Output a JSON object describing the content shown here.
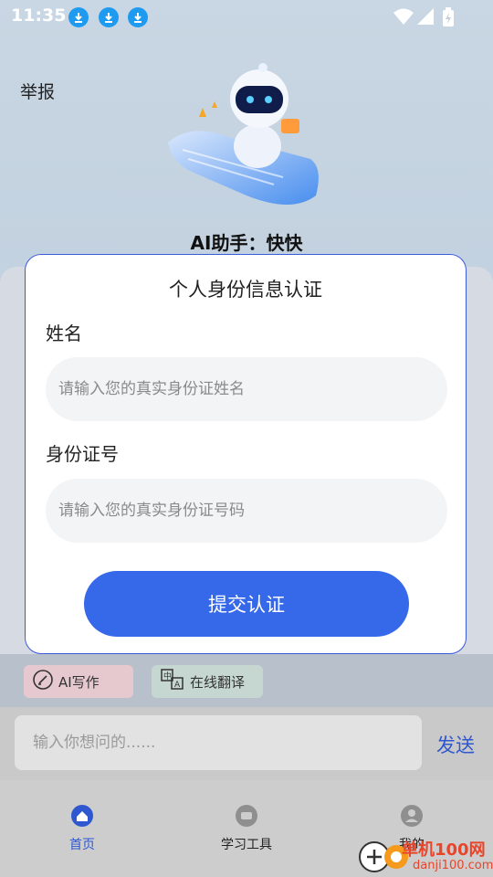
{
  "status_bar": {
    "time": "11:35"
  },
  "header": {
    "report_label": "举报",
    "assistant_title": "AI助手：快快"
  },
  "modal": {
    "title": "个人身份信息认证",
    "name_label": "姓名",
    "name_placeholder": "请输入您的真实身份证姓名",
    "id_label": "身份证号",
    "id_placeholder": "请输入您的真实身份证号码",
    "submit_label": "提交认证"
  },
  "quick_actions": [
    {
      "label": "AI写作",
      "icon": "pen-icon",
      "bg": "#e6c9cf"
    },
    {
      "label": "在线翻译",
      "icon": "translate-icon",
      "bg": "#c6d7d2"
    }
  ],
  "chat": {
    "placeholder": "输入你想问的......",
    "send_label": "发送"
  },
  "tabbar": {
    "items": [
      {
        "label": "首页",
        "icon": "home-icon",
        "active": true
      },
      {
        "label": "学习工具",
        "icon": "tools-icon",
        "active": false
      },
      {
        "label": "我的",
        "icon": "profile-icon",
        "active": false
      }
    ]
  },
  "watermark": {
    "brand": "单机100网",
    "domain": "danji100.com"
  },
  "colors": {
    "accent": "#3668ea",
    "send": "#2f57d0",
    "active_tab": "#2f57d0"
  }
}
